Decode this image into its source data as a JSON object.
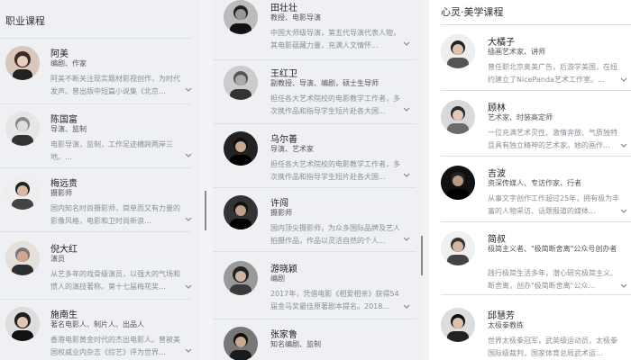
{
  "column1": {
    "title": "职业课程",
    "cards": [
      {
        "name": "阿美",
        "role": "编剧、作家",
        "desc": "阿美不断关注现实题材影视创作，为时代发声。曾出版中短篇小说集《北京..."
      },
      {
        "name": "陈国富",
        "role": "导演、监制",
        "desc": "电影导演，监制，工作足迹横跨两岸三地。..."
      },
      {
        "name": "梅远贵",
        "role": "摄影师",
        "desc": "国内知名时尚摄影师，简单而又有力量的影像风格，电影和卫时尚新浪..."
      },
      {
        "name": "倪大红",
        "role": "演员",
        "desc": "从艺多年的戏骨级演员，以强大的气场和惯人的演技著称。第十七届梅花奖..."
      },
      {
        "name": "施南生",
        "role": "著名电影人、制片人、出品人",
        "desc": "香港电影黄金时代的杰出电影人。曾被美国权威业内杂志《综艺》评为世界..."
      }
    ]
  },
  "column2": {
    "cards": [
      {
        "name": "田壮壮",
        "role": "教授、电影导演",
        "desc": "中国大师级导演，第五代导演代表人物，其电影蕴藏力量，充满人文情怀..."
      },
      {
        "name": "王红卫",
        "role": "副教授、导演、编剧，硕士生导师",
        "desc": "担任各大艺术院校的电影教学工作者，多次携作品和指导学生短片赴各大国..."
      },
      {
        "name": "乌尔善",
        "role": "导演、艺术家",
        "desc": "担任各大艺术院校的电影教学工作者，多次携作品和指导学生短片赴各大国..."
      },
      {
        "name": "许闯",
        "role": "摄影师",
        "desc": "国内顶尖摄影师，为众多国际品牌及艺人拍摄作品，作品以灵活自然的个人..."
      },
      {
        "name": "游晓颖",
        "role": "编剧",
        "desc": "2017年，凭借电影《相爱相亲》获得54届金马奖最佳原著剧本提名。2018..."
      },
      {
        "name": "张家鲁",
        "role": "知名编剧、监制",
        "desc": "..."
      }
    ]
  },
  "column3": {
    "title": "心灵·美学课程",
    "cards": [
      {
        "name": "大橘子",
        "role": "插画艺术家、讲师",
        "desc": "曾任职北京奥美广告，后游学美国，在纽约建立了NicePanda艺术工作室。..."
      },
      {
        "name": "顾林",
        "role": "艺术家、时装高定师",
        "desc": "一位充满艺术灵性、激情奔放、气质独特且具有独立精神的艺术家。她的画作..."
      },
      {
        "name": "吉波",
        "role": "资深传媒人、专访作家、行者",
        "desc": "从事文字创作工作超过25年，拥有极为丰富的人物采访、话题报道的媒体..."
      },
      {
        "name": "简叔",
        "role": "极简主义者、\"极简断舍离\"公众号创办者",
        "desc": "践行极简生活多年，潜心研究极简主义、断舍离，创办\"极简断舍离\"公众..."
      },
      {
        "name": "邱慧芳",
        "role": "太极拳教练",
        "desc": "世界太极拳冠军，武英级运动员，太极拳国际级裁判，国家体育总局武术运..."
      }
    ]
  },
  "colors": {
    "bg": "#eef0f3",
    "divider": "#dcdfe4",
    "desc": "#8a8f96"
  },
  "icons": {
    "expand": "chevron-down-icon"
  }
}
